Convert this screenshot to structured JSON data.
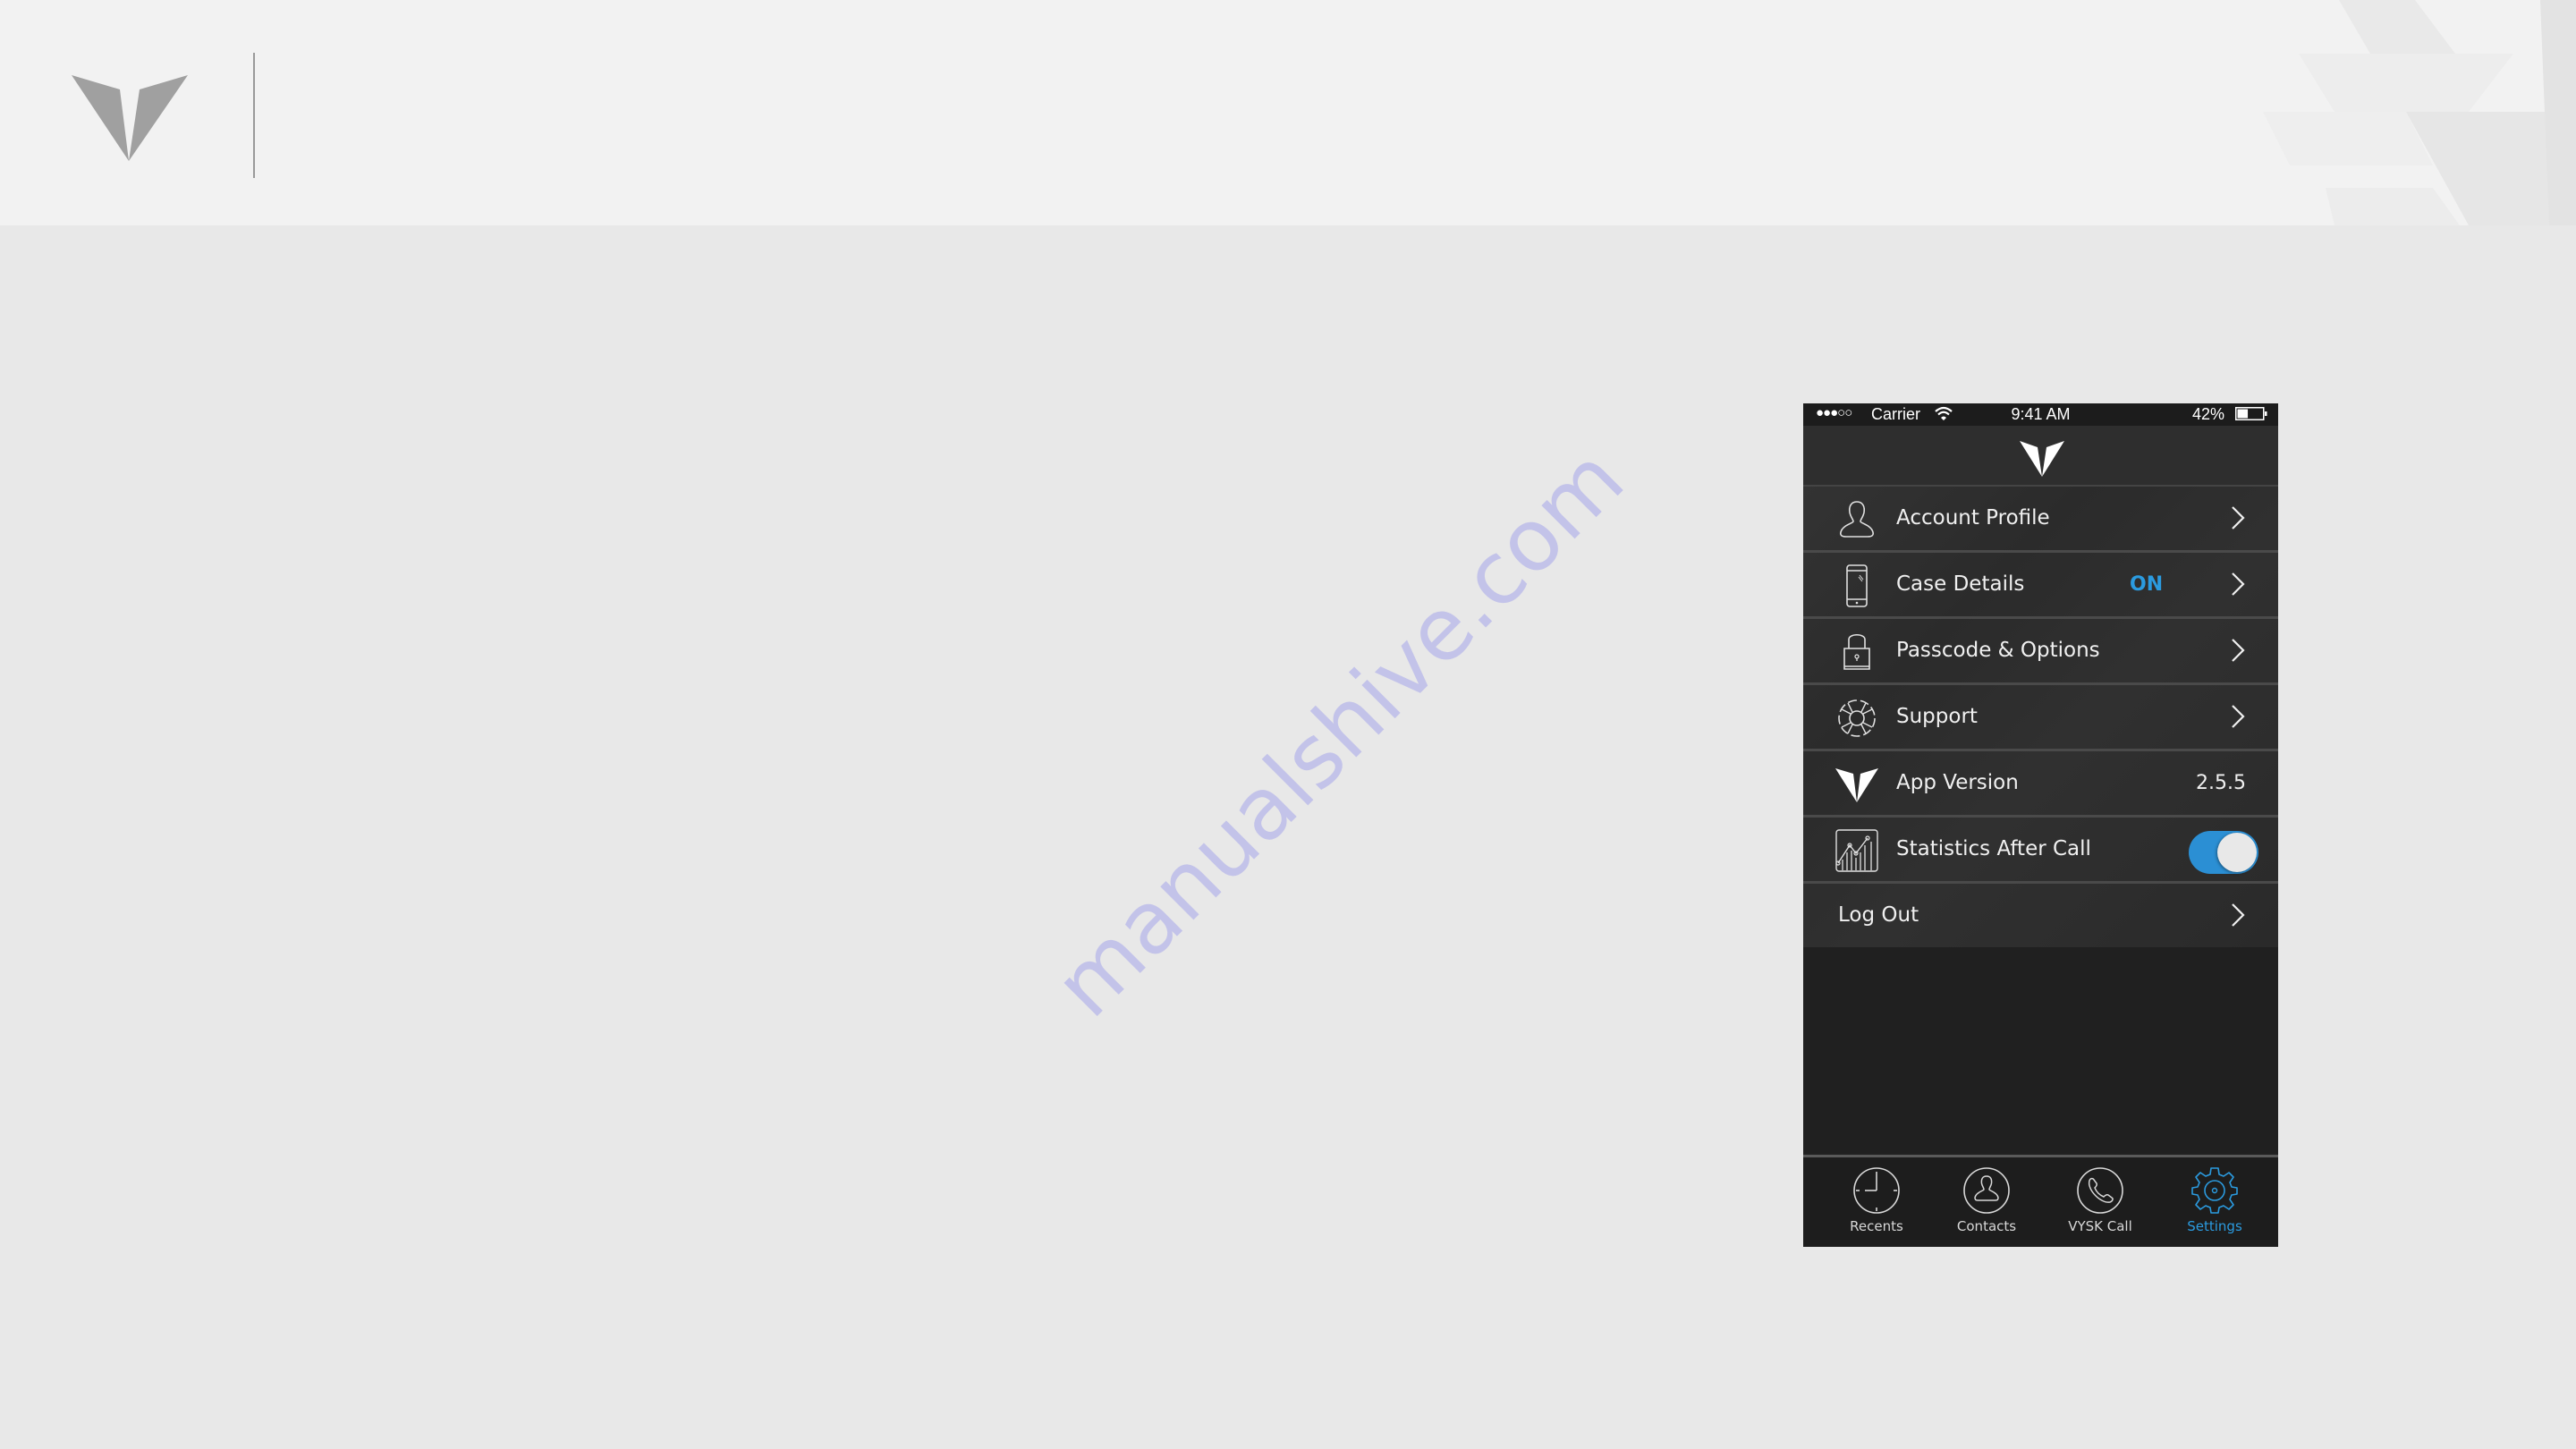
{
  "slide": {
    "watermark": "manualshive.com"
  },
  "status_bar": {
    "signal": "●●●○○",
    "carrier": "Carrier",
    "time": "9:41 AM",
    "battery_percent": "42%",
    "battery_level": 0.42
  },
  "menu": {
    "items": [
      {
        "label": "Account Profile",
        "icon": "user-icon"
      },
      {
        "label": "Case Details",
        "icon": "phone-icon",
        "status": "ON"
      },
      {
        "label": "Passcode & Options",
        "icon": "lock-icon"
      },
      {
        "label": "Support",
        "icon": "lifebuoy-icon"
      },
      {
        "label": "App Version",
        "icon": "vysk-logo-icon",
        "value": "2.5.5"
      },
      {
        "label": "Statistics After Call",
        "icon": "chart-icon",
        "toggle_on": true
      },
      {
        "label": "Log Out"
      }
    ]
  },
  "tabs": [
    {
      "label": "Recents",
      "icon": "clock-icon",
      "active": false
    },
    {
      "label": "Contacts",
      "icon": "contact-icon",
      "active": false
    },
    {
      "label": "VYSK Call",
      "icon": "phone-call-icon",
      "active": false
    },
    {
      "label": "Settings",
      "icon": "gear-icon",
      "active": true
    }
  ],
  "colors": {
    "accent": "#2b9be0",
    "toggle_on": "#2b8fd4",
    "phone_bg": "#212121",
    "slide_bg": "#e8e8e8",
    "header_bg": "#f2f2f2"
  }
}
